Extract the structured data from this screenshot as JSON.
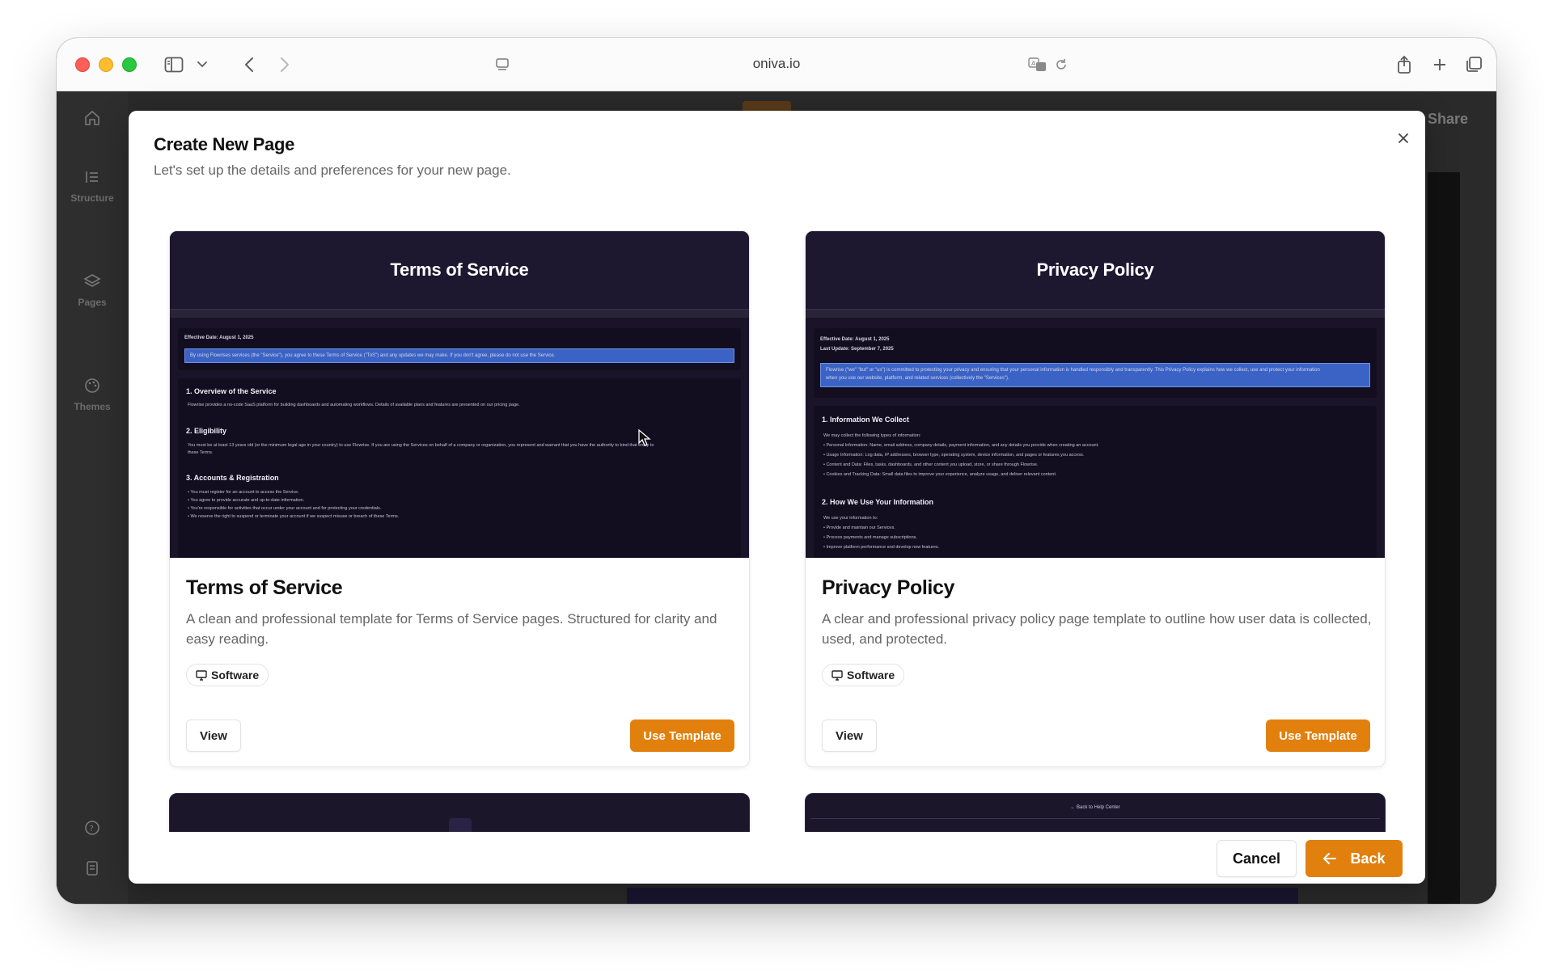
{
  "browser": {
    "url": "oniva.io"
  },
  "sidebar": {
    "items": [
      {
        "label": "",
        "icon": "home-icon"
      },
      {
        "label": "Structure",
        "icon": "structure-icon"
      },
      {
        "label": "Pages",
        "icon": "layers-icon"
      },
      {
        "label": "Themes",
        "icon": "palette-icon"
      }
    ]
  },
  "background": {
    "share_label": "Share"
  },
  "modal": {
    "title": "Create New Page",
    "subtitle": "Let's set up the details and preferences for your new page.",
    "cancel_label": "Cancel",
    "back_label": "Back"
  },
  "templates": [
    {
      "preview_title": "Terms of Service",
      "preview": {
        "effective": "Effective Date: August 1, 2025",
        "banner": "By using Flowrises services (the \"Service\"), you agree to these Terms of Service (\"ToS\") and any updates we may make. If you don't agree, please do not use the Service.",
        "s1": "1. Overview of the Service",
        "s1_text": "Flowrise provides a no-code SaaS platform for building dashboards and automating workflows. Details of available plans and features are presented on our pricing page.",
        "s2": "2. Eligibility",
        "s2_text": "You must be at least 13 years old (or the minimum legal age in your country) to use Flowrise. If you are using the Services on behalf of a company or organization, you represent and warrant that you have the authority to bind that entity to",
        "s2_text2": "these Terms.",
        "s3": "3. Accounts & Registration",
        "s3_b1": "• You must register for an account to access the Service.",
        "s3_b2": "• You agree to provide accurate and up-to-date information.",
        "s3_b3": "• You're responsible for activities that occur under your account and for protecting your credentials.",
        "s3_b4": "• We reserve the right to suspend or terminate your account if we suspect misuse or breach of these Terms."
      },
      "title": "Terms of Service",
      "description": "A clean and professional template for Terms of Service pages. Structured for clarity and easy reading.",
      "tag": "Software",
      "view_label": "View",
      "use_label": "Use Template"
    },
    {
      "preview_title": "Privacy Policy",
      "preview": {
        "effective": "Effective Date: August 1, 2025",
        "updated": "Last Update: September 7, 2025",
        "banner": "Flowrise (\"we\" \"but\" or \"us\") is committed to protecting your privacy and ensuring that your personal information is handled responsibly and transparently. This Privacy Policy explains how we collect, use and protect your information",
        "banner2": "when you use our website, platform, and related services (collectively the \"Services\").",
        "s1": "1. Information We Collect",
        "s1_intro": "We may collect the following types of information:",
        "s1_b1": "• Personal Information: Name, email address, company details, payment information, and any details you provide when creating an account.",
        "s1_b2": "• Usage Information: Log data, IP addresses, browser type, operating system, device information, and pages or features you access.",
        "s1_b3": "• Content and Data: Files, tasks, dashboards, and other content you upload, store, or share through Flowrise.",
        "s1_b4": "• Cookies and Tracking Data: Small data files to improve your experience, analyze usage, and deliver relevant content.",
        "s2": "2. How We Use Your Information",
        "s2_intro": "We use your information to:",
        "s2_b1": "• Provide and maintain our Services.",
        "s2_b2": "• Process payments and manage subscriptions.",
        "s2_b3": "• Improve platform performance and develop new features."
      },
      "title": "Privacy Policy",
      "description": "A clear and professional privacy policy page template to outline how user data is collected, used, and protected.",
      "tag": "Software",
      "view_label": "View",
      "use_label": "Use Template"
    }
  ],
  "partial_cards": [
    {
      "link": ""
    },
    {
      "link": "← Back to Help Center"
    }
  ],
  "colors": {
    "accent": "#e2800e",
    "preview_bg": "#1a1429",
    "banner": "#3a63c5"
  }
}
